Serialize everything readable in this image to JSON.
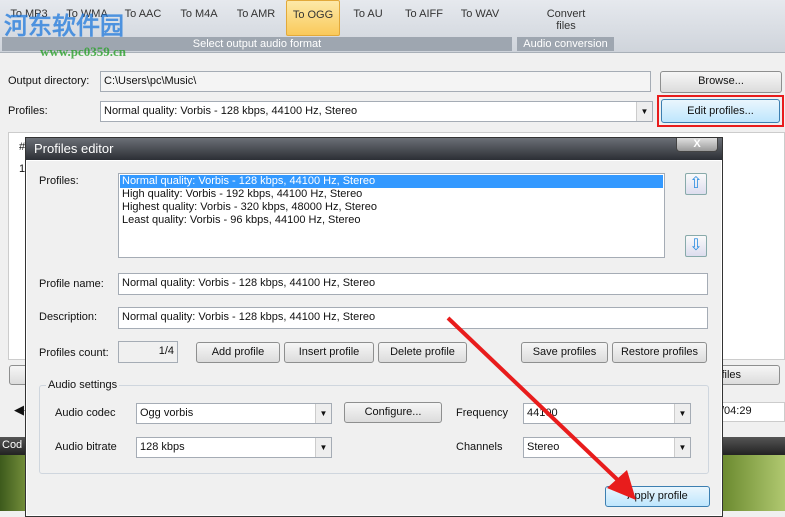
{
  "ribbon": {
    "formats": [
      {
        "label": "To MP3"
      },
      {
        "label": "To WMA"
      },
      {
        "label": "To AAC"
      },
      {
        "label": "To M4A"
      },
      {
        "label": "To AMR"
      },
      {
        "label": "To OGG"
      },
      {
        "label": "To AU"
      },
      {
        "label": "To AIFF"
      },
      {
        "label": "To WAV"
      }
    ],
    "format_group": "Select output audio format",
    "convert": "Convert files",
    "convert_group": "Audio conversion"
  },
  "watermark": {
    "name": "河东软件园",
    "url": "www.pc0359.cn"
  },
  "main": {
    "output_label": "Output directory:",
    "output_value": "C:\\Users\\pc\\Music\\",
    "browse": "Browse...",
    "profiles_label": "Profiles:",
    "profile_value": "Normal quality: Vorbis - 128 kbps, 44100 Hz, Stereo",
    "edit_profiles": "Edit profiles...",
    "files_button": "files",
    "time": "/04:29",
    "codec_bar": "Cod",
    "list_hash": "#",
    "list_row": "1"
  },
  "dialog": {
    "title": "Profiles editor",
    "close": "X",
    "profiles_label": "Profiles:",
    "profiles": [
      "Normal quality: Vorbis - 128 kbps, 44100 Hz, Stereo",
      "High quality: Vorbis - 192 kbps, 44100 Hz, Stereo",
      "Highest quality: Vorbis - 320 kbps, 48000 Hz, Stereo",
      "Least quality: Vorbis - 96 kbps, 44100 Hz, Stereo"
    ],
    "name_label": "Profile name:",
    "name_value": "Normal quality: Vorbis - 128 kbps, 44100 Hz, Stereo",
    "desc_label": "Description:",
    "desc_value": "Normal quality: Vorbis - 128 kbps, 44100 Hz, Stereo",
    "count_label": "Profiles count:",
    "count_value": "1/4",
    "add": "Add profile",
    "insert": "Insert profile",
    "delete": "Delete profile",
    "save": "Save profiles",
    "restore": "Restore profiles",
    "audio_settings": "Audio settings",
    "codec_label": "Audio codec",
    "codec_value": "Ogg vorbis",
    "configure": "Configure...",
    "frequency_label": "Frequency",
    "frequency_value": "44100",
    "bitrate_label": "Audio bitrate",
    "bitrate_value": "128 kbps",
    "channels_label": "Channels",
    "channels_value": "Stereo",
    "apply": "Apply profile"
  },
  "colors": {
    "highlight": "#e81c1c",
    "selection": "#3399ff"
  }
}
